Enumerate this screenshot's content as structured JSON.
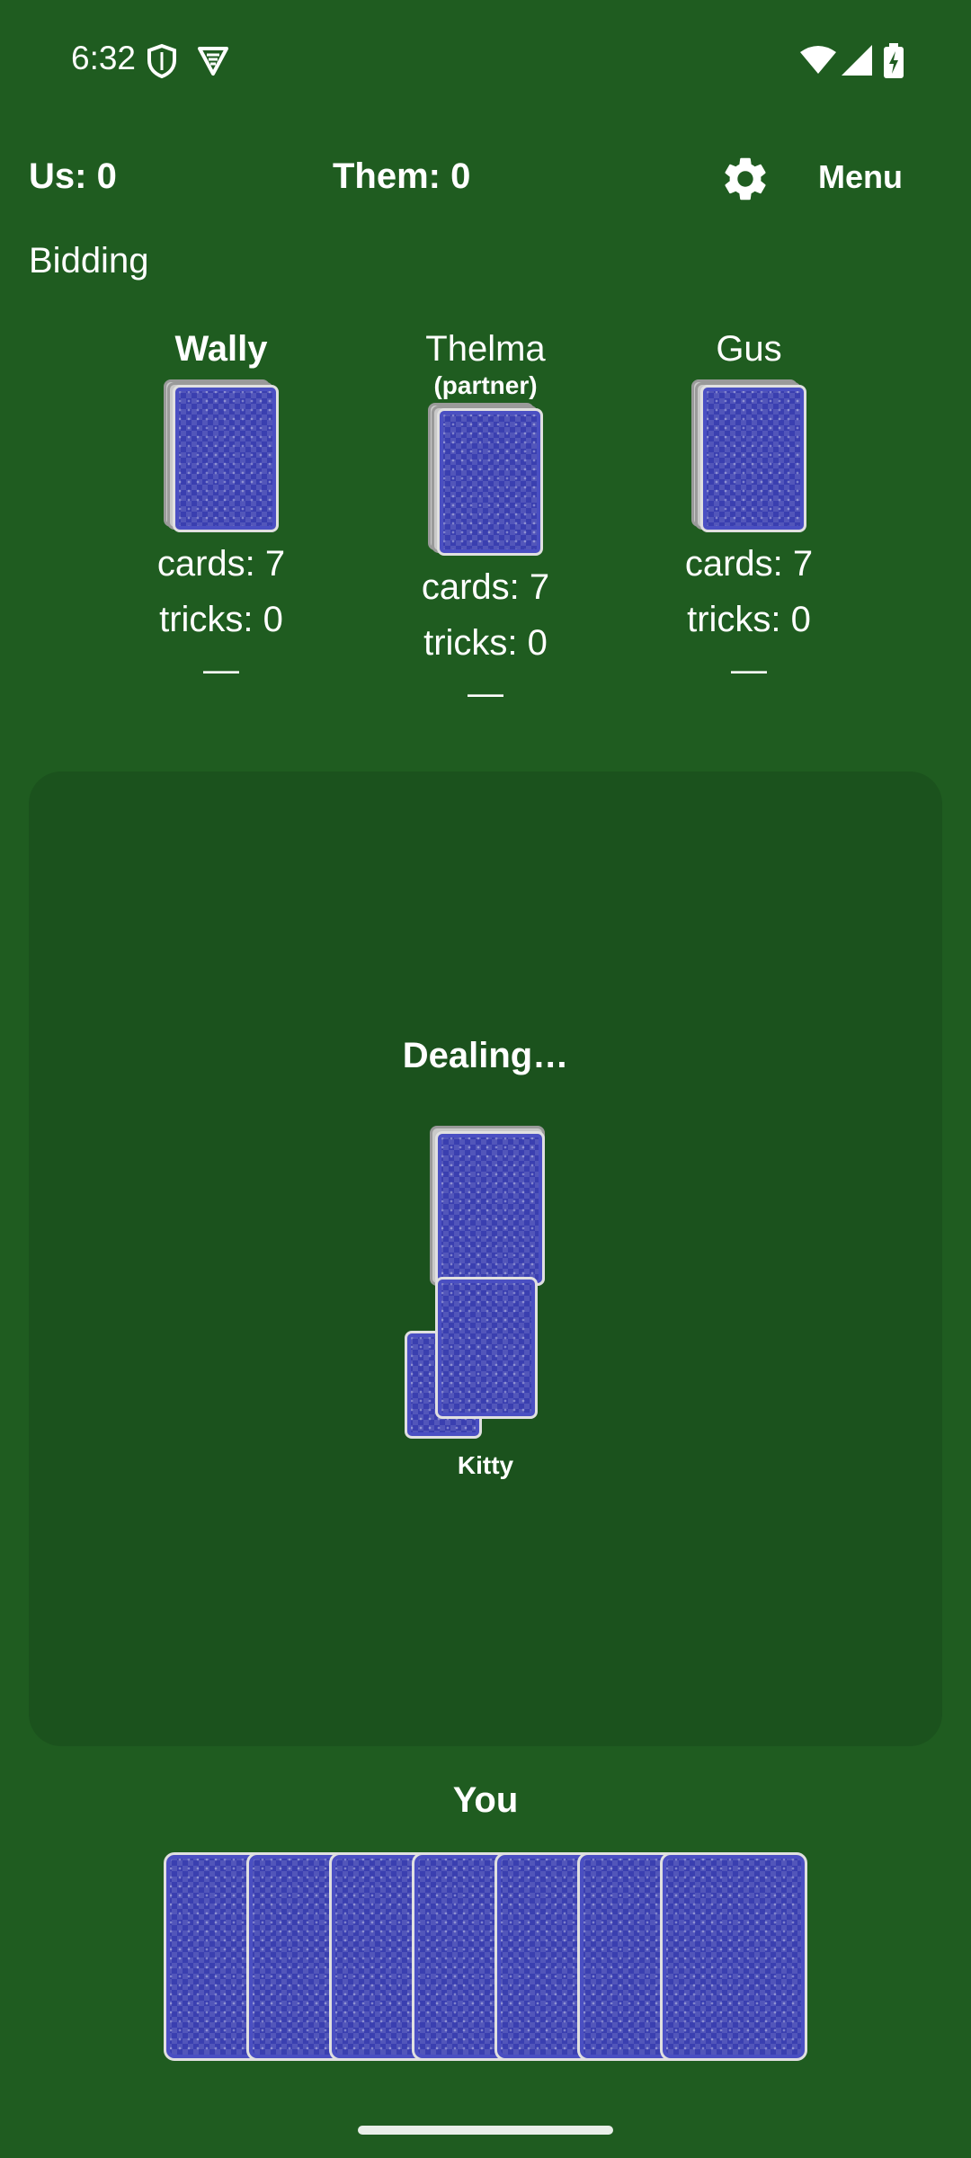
{
  "status_bar": {
    "time": "6:32",
    "icons": [
      "shield-icon",
      "vpn-icon",
      "wifi-icon",
      "signal-icon",
      "battery-charging-icon"
    ]
  },
  "header": {
    "score_us": "Us: 0",
    "score_them": "Them: 0",
    "settings_icon": "gear-icon",
    "menu_label": "Menu"
  },
  "phase": "Bidding",
  "players": [
    {
      "name": "Wally",
      "subtitle": "",
      "cards": "cards: 7",
      "tricks": "tricks: 0",
      "bid": "—"
    },
    {
      "name": "Thelma",
      "subtitle": "(partner)",
      "cards": "cards: 7",
      "tricks": "tricks: 0",
      "bid": "—"
    },
    {
      "name": "Gus",
      "subtitle": "",
      "cards": "cards: 7",
      "tricks": "tricks: 0",
      "bid": "—"
    }
  ],
  "table": {
    "status": "Dealing…",
    "kitty_label": "Kitty"
  },
  "you": {
    "label": "You",
    "hand_count": 7
  },
  "colors": {
    "felt": "#1f5c20",
    "table_panel": "#1b521d",
    "card_back": "#3a3fb0"
  }
}
